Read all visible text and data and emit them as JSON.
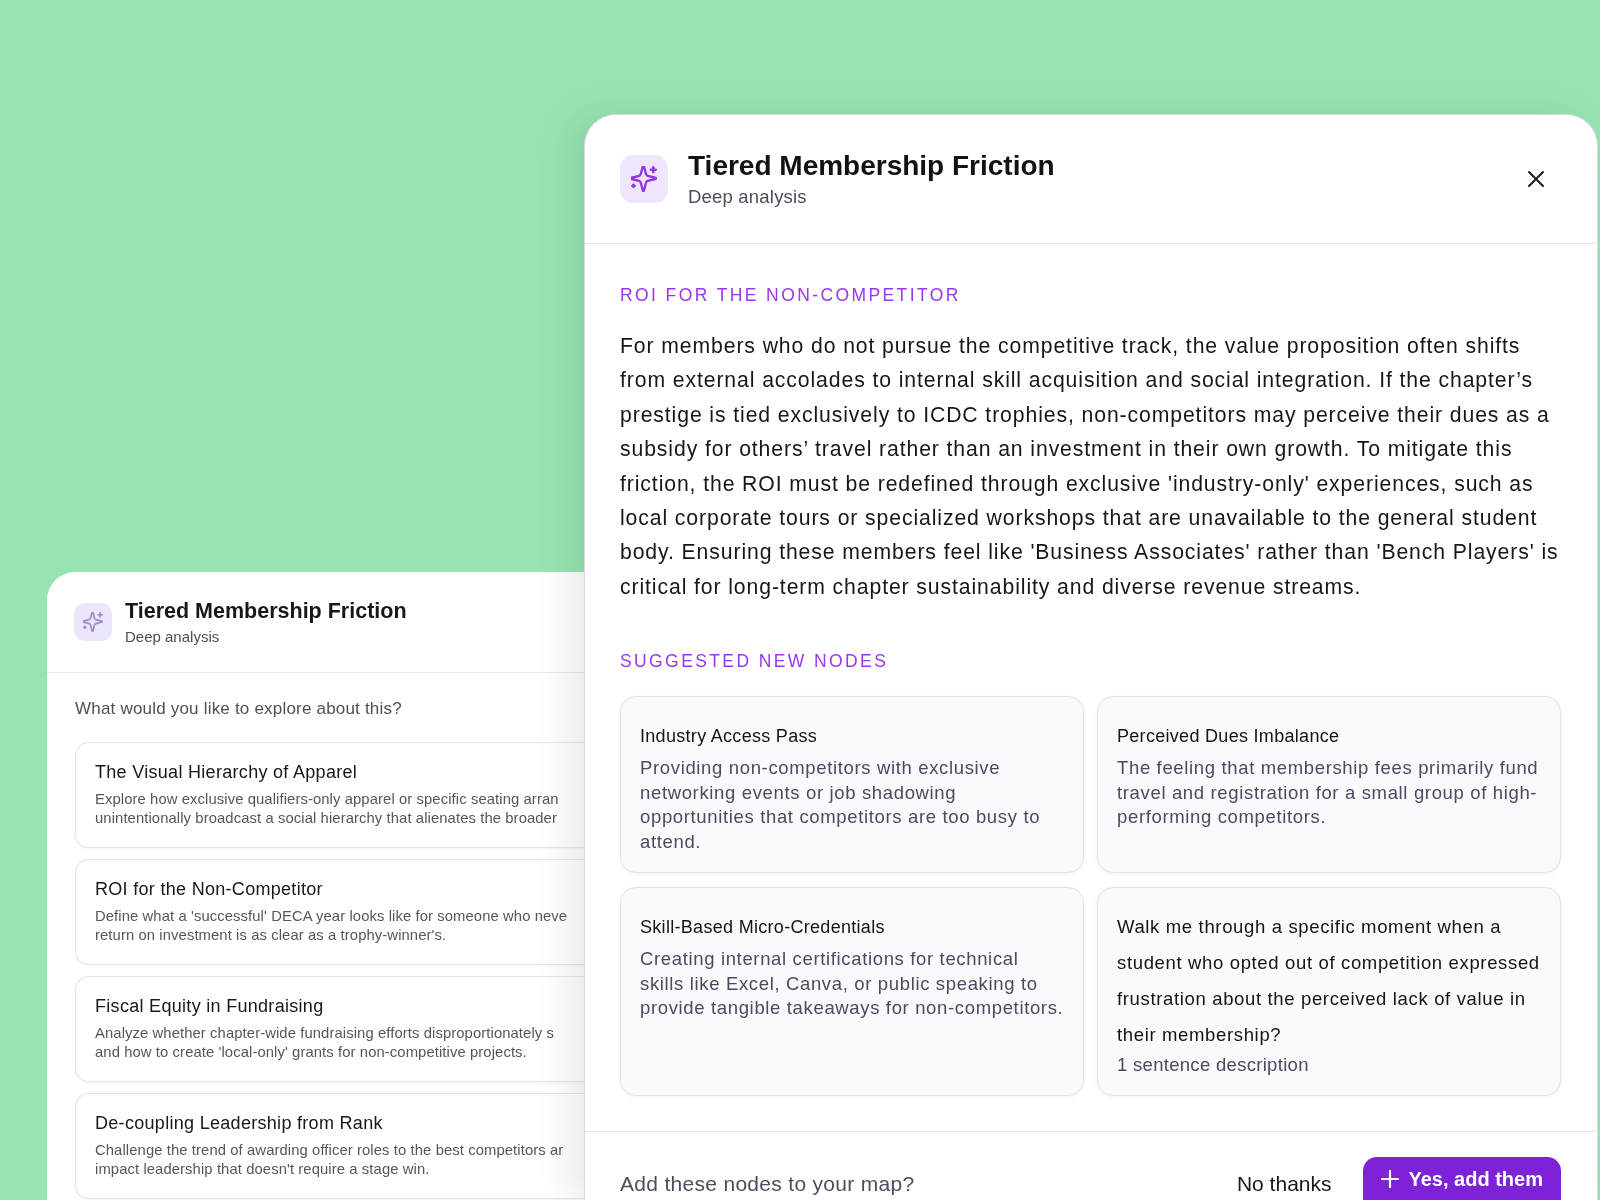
{
  "background_panel": {
    "title": "Tiered Membership Friction",
    "subtitle": "Deep analysis",
    "prompt": "What would you like to explore about this?",
    "options": [
      {
        "title": "The Visual Hierarchy of Apparel",
        "description_lines": [
          "Explore how exclusive qualifiers-only apparel or specific seating arran",
          "unintentionally broadcast a social hierarchy that alienates the broader"
        ]
      },
      {
        "title": "ROI for the Non-Competitor",
        "description_lines": [
          "Define what a 'successful' DECA year looks like for someone who neve",
          "return on investment is as clear as a trophy-winner's."
        ]
      },
      {
        "title": "Fiscal Equity in Fundraising",
        "description_lines": [
          "Analyze whether chapter-wide fundraising efforts disproportionately s",
          "and how to create 'local-only' grants for non-competitive projects."
        ]
      },
      {
        "title": "De-coupling Leadership from Rank",
        "description_lines": [
          "Challenge the trend of awarding officer roles to the best competitors ar",
          "impact leadership that doesn't require a stage win."
        ]
      }
    ]
  },
  "dialog": {
    "title": "Tiered Membership Friction",
    "subtitle": "Deep analysis",
    "analysis_heading": "ROI FOR THE NON-COMPETITOR",
    "analysis_text": "For members who do not pursue the competitive track, the value proposition often shifts from external accolades to internal skill acquisition and social integration. If the chapter’s prestige is tied exclusively to ICDC trophies, non-competitors may perceive their dues as a subsidy for others’ travel rather than an investment in their own growth. To mitigate this friction, the ROI must be redefined through exclusive 'industry-only' experiences, such as local corporate tours or specialized workshops that are unavailable to the general student body. Ensuring these members feel like 'Business Associates' rather than 'Bench Players' is critical for long-term chapter sustainability and diverse revenue streams.",
    "suggestions_heading": "SUGGESTED NEW NODES",
    "suggested_nodes": [
      {
        "kind": "node",
        "title": "Industry Access Pass",
        "description": "Providing non-competitors with exclusive networking events or job shadowing opportunities that competitors are too busy to attend."
      },
      {
        "kind": "node",
        "title": "Perceived Dues Imbalance",
        "description": "The feeling that membership fees primarily fund travel and registration for a small group of high-performing competitors."
      },
      {
        "kind": "node",
        "title": "Skill-Based Micro-Credentials",
        "description": "Creating internal certifications for technical skills like Excel, Canva, or public speaking to provide tangible takeaways for non-competitors."
      },
      {
        "kind": "draft",
        "title": "Walk me through a specific moment when a student who opted out of competition expressed frustration about the perceived lack of value in their membership?",
        "placeholder": "1 sentence description"
      }
    ],
    "footer": {
      "question": "Add these nodes to your map?",
      "buttons": [
        {
          "kind": "secondary",
          "label": "No thanks"
        },
        {
          "kind": "primary",
          "label": "Yes, add them"
        }
      ]
    }
  }
}
